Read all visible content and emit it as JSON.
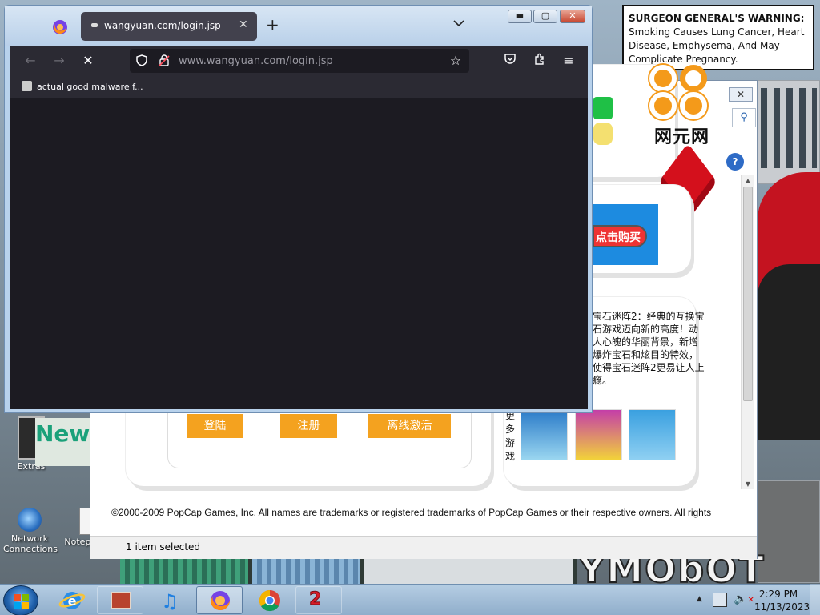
{
  "desktop": {
    "warning_label": "SURGEON GENERAL'S WARNING:",
    "warning_text": "Smoking Causes Lung Cancer, Heart Disease, Emphysema, And May Complicate Pregnancy.",
    "wallpaper_sign": "YMObOT",
    "icons": [
      {
        "label": "Extras"
      },
      {
        "label": "Network Connections"
      },
      {
        "label": "Notepad++"
      }
    ],
    "partial_sign": "New"
  },
  "ie_window": {
    "status": "1 item selected",
    "logo_text": "网元网",
    "buy_label": "点击购买",
    "description": "宝石迷阵2：经典的互换宝石游戏迈向新的高度！动人心魄的华丽背景，新增爆炸宝石和炫目的特效，使得宝石迷阵2更易让人上瘾。",
    "more_games": "更多游戏",
    "buttons": {
      "login": "登陆",
      "register": "注册",
      "offline": "离线激活"
    },
    "copyright": "©2000-2009 PopCap Games, Inc. All names are trademarks or registered trademarks of PopCap Games or their respective owners. All rights"
  },
  "firefox": {
    "tab_title": "wangyuan.com/login.jsp",
    "url": "www.wangyuan.com/login.jsp",
    "bookmark": "actual good malware f..."
  },
  "taskbar": {
    "time": "2:29 PM",
    "date": "11/13/2023"
  }
}
